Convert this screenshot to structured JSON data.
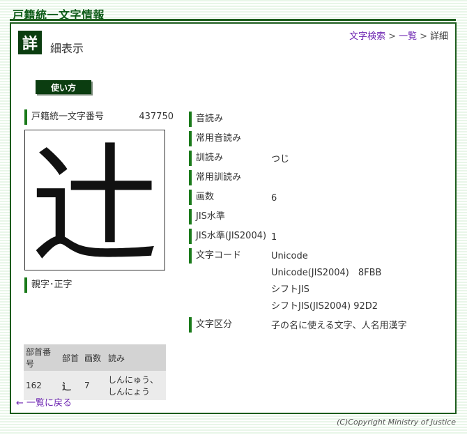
{
  "site": {
    "title": "戸籍統一文字情報"
  },
  "heading": {
    "badge": "詳",
    "rest": "細表示"
  },
  "breadcrumb": [
    {
      "label": "文字検索",
      "link": true
    },
    {
      "label": "一覧",
      "link": true
    },
    {
      "label": "詳細",
      "link": false
    }
  ],
  "breadcrumb_sep": ">",
  "howto_button": "使い方",
  "char_code": {
    "label": "戸籍統一文字番号",
    "value": "437750"
  },
  "glyph": "辻",
  "variant_label": "親字･正字",
  "attributes": {
    "onyomi": {
      "label": "音読み",
      "values": []
    },
    "joyo_onyomi": {
      "label": "常用音読み",
      "values": []
    },
    "kunyomi": {
      "label": "訓読み",
      "values": [
        "つじ"
      ]
    },
    "joyo_kunyomi": {
      "label": "常用訓読み",
      "values": []
    },
    "stroke_count": {
      "label": "画数",
      "values": [
        "6"
      ]
    },
    "jis_level": {
      "label": "JIS水準",
      "values": []
    },
    "jis_level_2004": {
      "label": "JIS水準(JIS2004)",
      "values": [
        "1"
      ]
    },
    "char_codes": {
      "label": "文字コード",
      "values": [
        "Unicode",
        "Unicode(JIS2004)　8FBB",
        "シフトJIS",
        "シフトJIS(JIS2004) 92D2"
      ]
    },
    "char_class": {
      "label": "文字区分",
      "values": [
        "子の名に使える文字、人名用漢字"
      ]
    }
  },
  "radical_table": {
    "headers": [
      "部首番号",
      "部首",
      "画数",
      "読み"
    ],
    "row": {
      "number": "162",
      "radical": "辶",
      "strokes": "7",
      "reading": "しんにゅう、しんにょう"
    }
  },
  "back_link": "← 一覧に戻る",
  "copyright": "(C)Copyright Ministry of Justice",
  "colors": {
    "brand_green": "#0b3d10",
    "accent_bar": "#1a7a1a",
    "link": "#6b22b0"
  }
}
